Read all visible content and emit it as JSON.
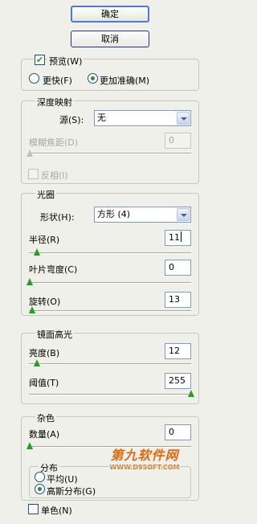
{
  "buttons": {
    "ok": "确定",
    "cancel": "取消"
  },
  "preview": {
    "label": "预览(W)",
    "checked": true,
    "option_faster": "更快(F)",
    "option_accurate": "更加准确(M)",
    "selected": "更加准确(M)"
  },
  "depth_map": {
    "legend": "深度映射",
    "source_label": "源(S):",
    "source_value": "无",
    "blur_focal_label": "模糊焦距(D)",
    "blur_focal_value": "0",
    "invert_label": "反相(I)",
    "invert_checked": false
  },
  "iris": {
    "legend": "光圈",
    "shape_label": "形状(H):",
    "shape_value": "方形 (4)",
    "radius_label": "半径(R)",
    "radius_value": "11",
    "blade_label": "叶片弯度(C)",
    "blade_value": "0",
    "rotation_label": "旋转(O)",
    "rotation_value": "13",
    "slider_levels": {
      "radius": 0.11,
      "blade": 0.0,
      "rotation": 0.036
    }
  },
  "specular": {
    "legend": "镜面高光",
    "brightness_label": "亮度(B)",
    "brightness_value": "12",
    "threshold_label": "阈值(T)",
    "threshold_value": "255",
    "slider_levels": {
      "brightness": 0.12,
      "threshold": 1.0
    }
  },
  "noise": {
    "legend": "杂色",
    "amount_label": "数量(A)",
    "amount_value": "0",
    "distribution_legend": "分布",
    "uniform_label": "平均(U)",
    "gaussian_label": "高斯分布(G)",
    "selected": "高斯分布(G)",
    "monochrome_label": "单色(N)",
    "monochrome_checked": false,
    "slider_levels": {
      "amount": 0.0
    }
  },
  "watermark": {
    "line1": "第九软件网",
    "line2": "WWW.D9SOFT.COM"
  },
  "colors": {
    "accent": "#21a121",
    "border": "#c9c8bd",
    "background": "#f0f0ea"
  }
}
